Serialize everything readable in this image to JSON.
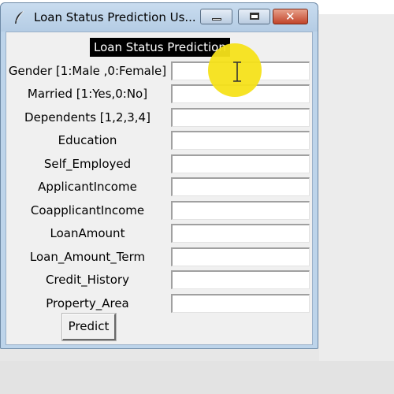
{
  "window": {
    "title": "Loan Status Prediction Us...",
    "controls": [
      "minimize",
      "maximize",
      "close"
    ],
    "close_glyph": "✕"
  },
  "form": {
    "heading": "Loan Status Prediction",
    "fields": [
      {
        "label": "Gender [1:Male ,0:Female]",
        "value": ""
      },
      {
        "label": "Married [1:Yes,0:No]",
        "value": ""
      },
      {
        "label": "Dependents [1,2,3,4]",
        "value": ""
      },
      {
        "label": "Education",
        "value": ""
      },
      {
        "label": "Self_Employed",
        "value": ""
      },
      {
        "label": "ApplicantIncome",
        "value": ""
      },
      {
        "label": "CoapplicantIncome",
        "value": ""
      },
      {
        "label": "LoanAmount",
        "value": ""
      },
      {
        "label": "Loan_Amount_Term",
        "value": ""
      },
      {
        "label": "Credit_History",
        "value": ""
      },
      {
        "label": "Property_Area",
        "value": ""
      }
    ],
    "submit_label": "Predict"
  },
  "icons": {
    "app": "feather-icon",
    "cursor": "text-cursor-icon"
  },
  "colors": {
    "heading_bg": "#000000",
    "close_button": "#c1442a",
    "cursor_highlight": "#f5e21a"
  }
}
